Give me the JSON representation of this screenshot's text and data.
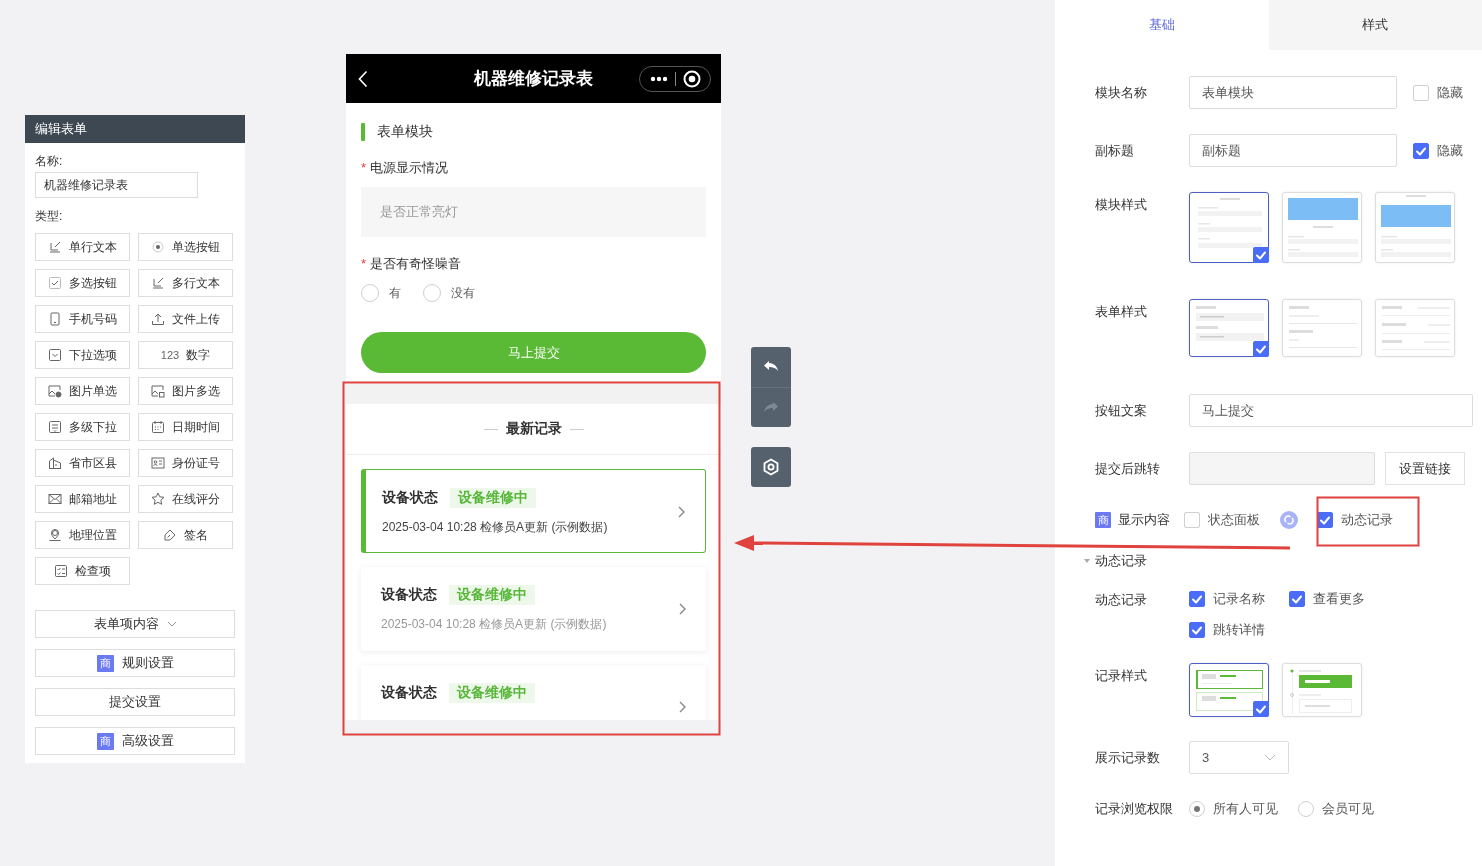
{
  "left_panel": {
    "title": "编辑表单",
    "name_label": "名称:",
    "name_value": "机器维修记录表",
    "type_label": "类型:",
    "field_types": [
      {
        "label": "单行文本"
      },
      {
        "label": "单选按钮"
      },
      {
        "label": "多选按钮"
      },
      {
        "label": "多行文本"
      },
      {
        "label": "手机号码"
      },
      {
        "label": "文件上传"
      },
      {
        "label": "下拉选项"
      },
      {
        "label": "数字",
        "icon_text": "123"
      },
      {
        "label": "图片单选"
      },
      {
        "label": "图片多选"
      },
      {
        "label": "多级下拉"
      },
      {
        "label": "日期时间"
      },
      {
        "label": "省市区县"
      },
      {
        "label": "身份证号"
      },
      {
        "label": "邮箱地址"
      },
      {
        "label": "在线评分"
      },
      {
        "label": "地理位置"
      },
      {
        "label": "签名"
      },
      {
        "label": "检查项"
      }
    ],
    "sections": [
      {
        "label": "表单项内容",
        "kind": "dropdown"
      },
      {
        "label": "规则设置",
        "kind": "premium",
        "badge": "商"
      },
      {
        "label": "提交设置",
        "kind": "plain"
      },
      {
        "label": "高级设置",
        "kind": "premium",
        "badge": "商"
      }
    ]
  },
  "phone": {
    "title": "机器维修记录表",
    "module_title": "表单模块",
    "questions": [
      {
        "kind": "text",
        "mark": "*",
        "label": "电源显示情况",
        "placeholder": "是否正常亮灯"
      },
      {
        "kind": "radio",
        "mark": "*",
        "label": "是否有奇怪噪音",
        "options": [
          {
            "label": "有",
            "selected": false
          },
          {
            "label": "没有",
            "selected": false
          }
        ]
      }
    ],
    "submit": "马上提交",
    "records_title": "最新记录",
    "records": [
      {
        "title": "设备状态",
        "status": "设备维修中",
        "meta": "2025-03-04 10:28  检修员A更新 (示例数据)",
        "selected": true
      },
      {
        "title": "设备状态",
        "status": "设备维修中",
        "meta": "2025-03-04 10:28  检修员A更新 (示例数据)",
        "selected": false
      },
      {
        "title": "设备状态",
        "status": "设备维修中",
        "selected": false
      }
    ]
  },
  "history_tools": [
    {
      "kind": "undo",
      "disabled": false
    },
    {
      "kind": "redo",
      "disabled": true
    },
    {
      "kind": "settings"
    }
  ],
  "settings": {
    "tabs": [
      {
        "label": "基础",
        "selected": true
      },
      {
        "label": "样式",
        "selected": false
      }
    ],
    "module_name": {
      "label": "模块名称",
      "value": "表单模块",
      "hide": {
        "label": "隐藏",
        "checked": false
      }
    },
    "subtitle": {
      "label": "副标题",
      "value": "副标题",
      "hide": {
        "label": "隐藏",
        "checked": true
      }
    },
    "module_style": {
      "label": "模块样式",
      "options": [
        {
          "selected": true
        },
        {
          "selected": false
        },
        {
          "selected": false
        }
      ]
    },
    "form_style": {
      "label": "表单样式",
      "options": [
        {
          "selected": true
        },
        {
          "selected": false
        },
        {
          "selected": false
        }
      ]
    },
    "button_text": {
      "label": "按钮文案",
      "value": "马上提交"
    },
    "redirect": {
      "label": "提交后跳转",
      "button": "设置链接"
    },
    "display": {
      "badge": "商",
      "label": "显示内容",
      "options": [
        {
          "label": "状态面板",
          "checked": false
        },
        {
          "label": "动态记录",
          "checked": true
        }
      ]
    },
    "dynamic_section": {
      "title": "动态记录",
      "expanded": true
    },
    "dynamic_fields": {
      "label": "动态记录",
      "options": [
        {
          "label": "记录名称",
          "checked": true
        },
        {
          "label": "查看更多",
          "checked": true
        },
        {
          "label": "跳转详情",
          "checked": true
        }
      ]
    },
    "record_style": {
      "label": "记录样式",
      "options": [
        {
          "selected": true
        },
        {
          "selected": false
        }
      ]
    },
    "record_count": {
      "label": "展示记录数",
      "value": "3"
    },
    "permission": {
      "label": "记录浏览权限",
      "options": [
        {
          "label": "所有人可见",
          "selected": true
        },
        {
          "label": "会员可见",
          "selected": false
        }
      ]
    }
  }
}
